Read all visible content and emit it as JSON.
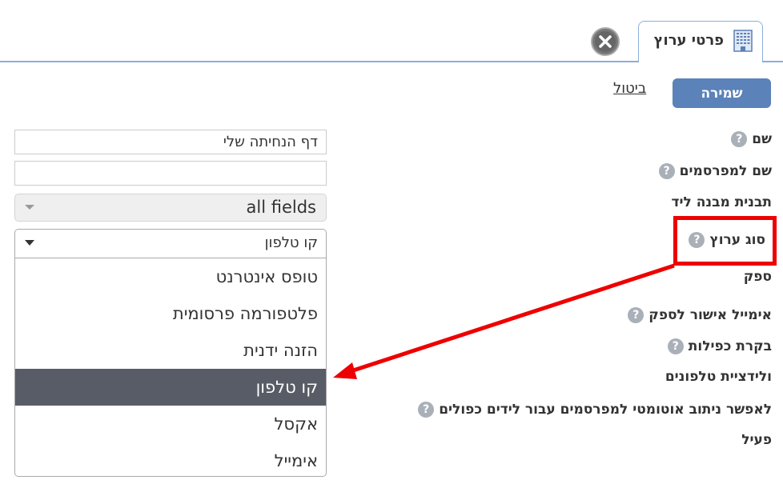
{
  "tab": {
    "label": "פרטי ערוץ",
    "icon": "building-icon",
    "close_icon": "close-circle-icon"
  },
  "actions": {
    "save_label": "שמירה",
    "cancel_label": "ביטול"
  },
  "form": {
    "fields": [
      {
        "label": "שם",
        "help": true
      },
      {
        "label": "שם למפרסמים",
        "help": true
      },
      {
        "label": "תבנית מבנה ליד",
        "help": false
      },
      {
        "label": "סוג ערוץ",
        "help": true
      },
      {
        "label": "ספק",
        "help": false
      },
      {
        "label": "אימייל אישור לספק",
        "help": true
      },
      {
        "label": "בקרת כפילות",
        "help": true
      },
      {
        "label": "ולידציית טלפונים",
        "help": false
      },
      {
        "label": "לאפשר ניתוב אוטומטי למפרסמים עבור לידים כפולים",
        "help": true
      },
      {
        "label": "פעיל",
        "help": false
      }
    ],
    "help_glyph": "?",
    "name_value": "דף הנחיתה שלי",
    "advertiser_name_value": "",
    "lead_template_value": "all fields",
    "channel_type": {
      "selected": "קו טלפון",
      "options": [
        "טופס אינטרנט",
        "פלטפורמה פרסומית",
        "הזנה ידנית",
        "קו טלפון",
        "אקסל",
        "אימייל"
      ],
      "selected_index": 3
    }
  },
  "annotation": {
    "color": "#ee0000"
  }
}
